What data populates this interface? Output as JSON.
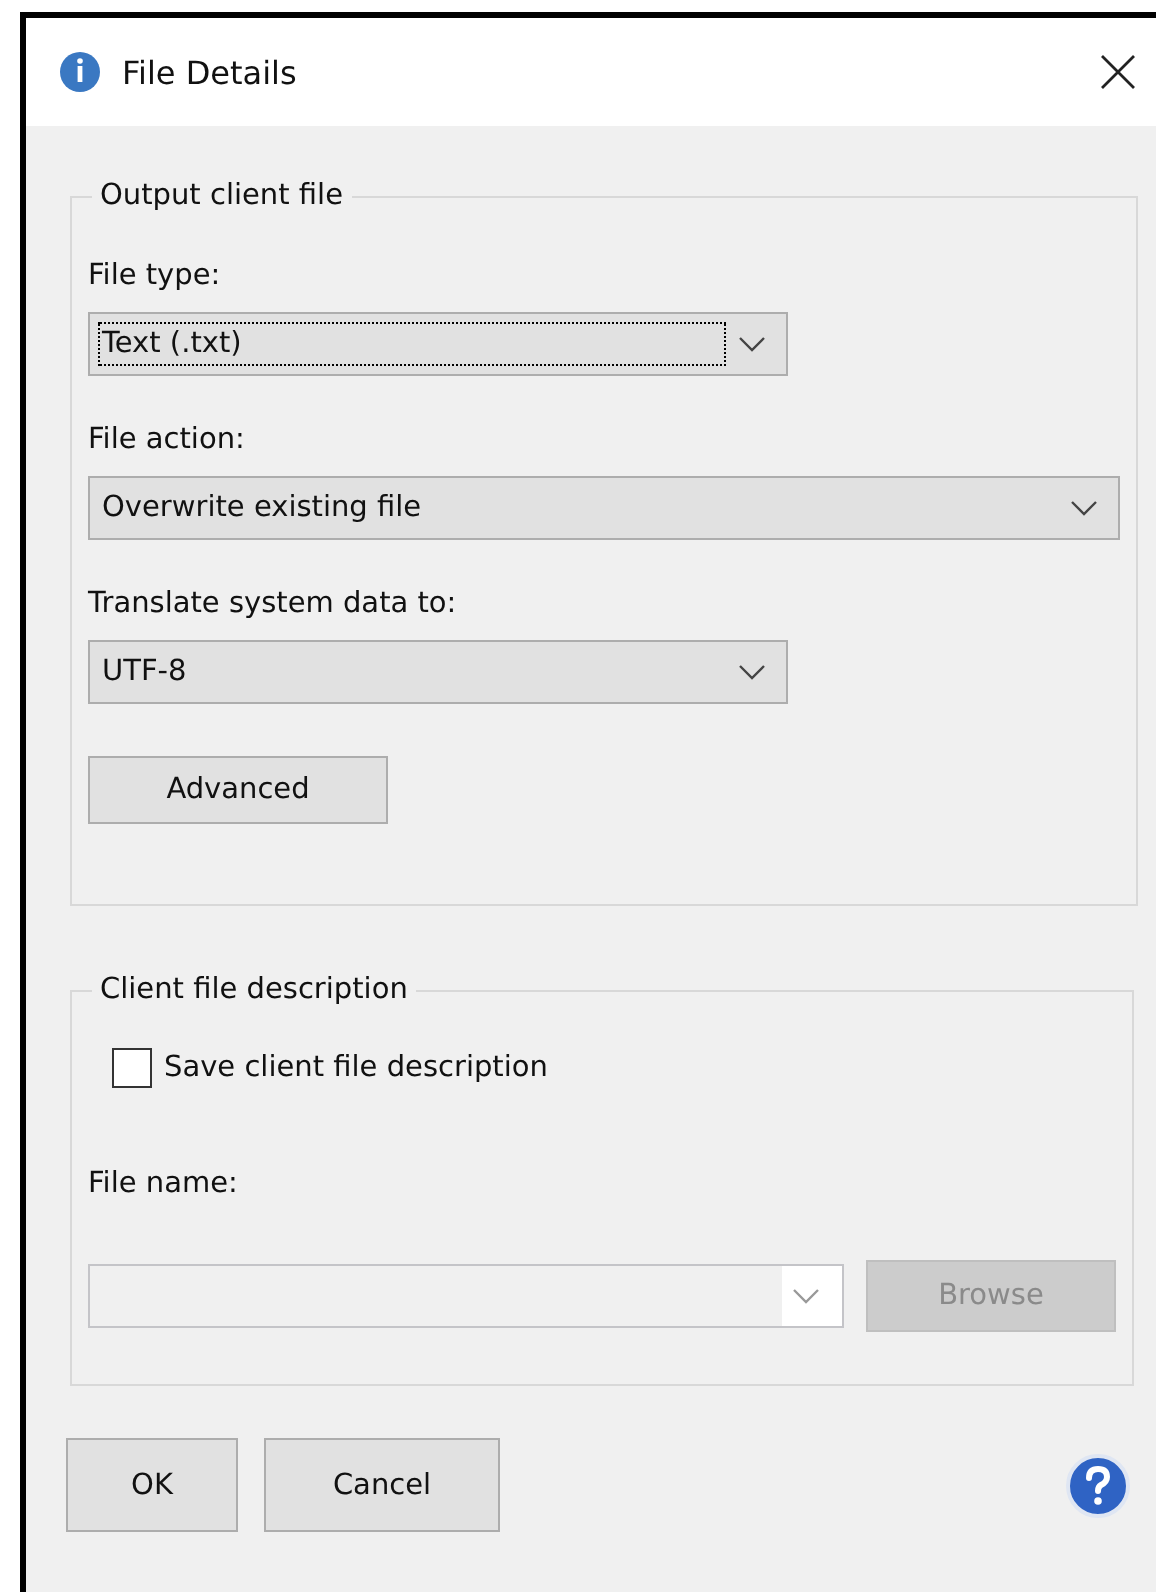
{
  "window": {
    "title": "File Details"
  },
  "output_group": {
    "title": "Output client file",
    "fields": [
      {
        "label": "File type:",
        "value": "Text (.txt)",
        "focused": true
      },
      {
        "label": "File action:",
        "value": "Overwrite existing file",
        "focused": false
      },
      {
        "label": "Translate system data to:",
        "value": "UTF-8",
        "focused": false
      }
    ],
    "advanced_button": "Advanced"
  },
  "description_group": {
    "title": "Client file description",
    "checkbox": {
      "label": "Save client file description",
      "checked": false
    },
    "file_name": {
      "label": "File name:",
      "disabled": true
    },
    "browse_button": {
      "label": "Browse",
      "disabled": true
    }
  },
  "buttons": [
    "OK",
    "Cancel"
  ]
}
